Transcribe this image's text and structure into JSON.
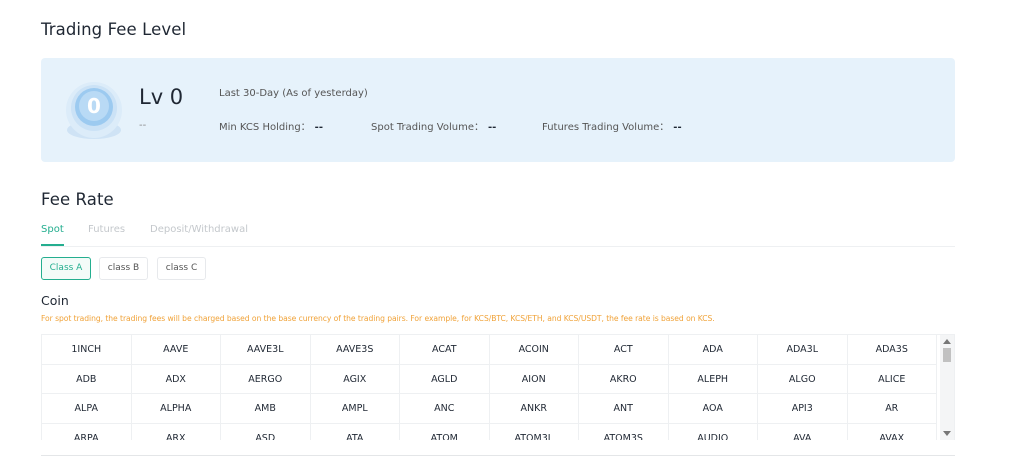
{
  "fee_level": {
    "title": "Trading Fee Level",
    "level": "Lv 0",
    "badge_number": "0",
    "sub": "--",
    "period": "Last 30-Day (As of yesterday)",
    "stats": [
      {
        "label": "Min KCS Holding：",
        "value": "--"
      },
      {
        "label": "Spot Trading Volume：",
        "value": "--"
      },
      {
        "label": "Futures Trading Volume：",
        "value": "--"
      }
    ]
  },
  "fee_rate": {
    "title": "Fee Rate",
    "tabs": [
      "Spot",
      "Futures",
      "Deposit/Withdrawal"
    ],
    "active_tab": "Spot",
    "classes": [
      "Class A",
      "class B",
      "class C"
    ],
    "active_class": "Class A"
  },
  "coin": {
    "title": "Coin",
    "note": "For spot trading, the trading fees will be charged based on the base currency of the trading pairs. For example, for KCS/BTC, KCS/ETH, and KCS/USDT, the fee rate is based on KCS.",
    "rows": [
      [
        "1INCH",
        "AAVE",
        "AAVE3L",
        "AAVE3S",
        "ACAT",
        "ACOIN",
        "ACT",
        "ADA",
        "ADA3L",
        "ADA3S"
      ],
      [
        "ADB",
        "ADX",
        "AERGO",
        "AGIX",
        "AGLD",
        "AION",
        "AKRO",
        "ALEPH",
        "ALGO",
        "ALICE"
      ],
      [
        "ALPA",
        "ALPHA",
        "AMB",
        "AMPL",
        "ANC",
        "ANKR",
        "ANT",
        "AOA",
        "API3",
        "AR"
      ],
      [
        "ARPA",
        "ARX",
        "ASD",
        "ATA",
        "ATOM",
        "ATOM3L",
        "ATOM3S",
        "AUDIO",
        "AVA",
        "AVAX"
      ]
    ]
  },
  "colors": {
    "accent": "#24ae8f",
    "card_bg": "#e6f2fb",
    "note": "#f0a238"
  },
  "icons": {
    "badge": "level-badge-icon",
    "scroll_up": "triangle-up-icon",
    "scroll_down": "triangle-down-icon"
  }
}
